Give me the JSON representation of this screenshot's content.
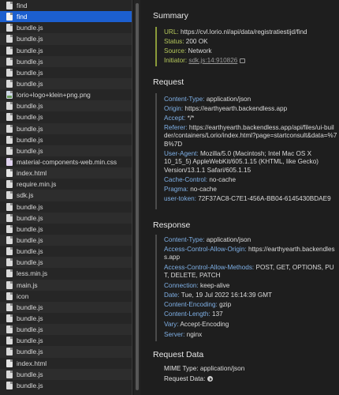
{
  "resources": [
    {
      "name": "find",
      "icon": "file-icon",
      "state": "normal"
    },
    {
      "name": "find",
      "icon": "file-icon",
      "state": "selected"
    },
    {
      "name": "bundle.js",
      "icon": "file-icon"
    },
    {
      "name": "bundle.js",
      "icon": "file-icon"
    },
    {
      "name": "bundle.js",
      "icon": "file-icon"
    },
    {
      "name": "bundle.js",
      "icon": "file-icon"
    },
    {
      "name": "bundle.js",
      "icon": "file-icon"
    },
    {
      "name": "bundle.js",
      "icon": "file-icon"
    },
    {
      "name": "lorio+logo+klein+png.png",
      "icon": "image-file-icon"
    },
    {
      "name": "bundle.js",
      "icon": "file-icon"
    },
    {
      "name": "bundle.js",
      "icon": "file-icon"
    },
    {
      "name": "bundle.js",
      "icon": "file-icon"
    },
    {
      "name": "bundle.js",
      "icon": "file-icon"
    },
    {
      "name": "bundle.js",
      "icon": "file-icon"
    },
    {
      "name": "material-components-web.min.css",
      "icon": "css-file-icon"
    },
    {
      "name": "index.html",
      "icon": "html-file-icon"
    },
    {
      "name": "require.min.js",
      "icon": "file-icon"
    },
    {
      "name": "sdk.js",
      "icon": "file-icon"
    },
    {
      "name": "bundle.js",
      "icon": "file-icon"
    },
    {
      "name": "bundle.js",
      "icon": "file-icon"
    },
    {
      "name": "bundle.js",
      "icon": "file-icon"
    },
    {
      "name": "bundle.js",
      "icon": "file-icon"
    },
    {
      "name": "bundle.js",
      "icon": "file-icon"
    },
    {
      "name": "bundle.js",
      "icon": "file-icon"
    },
    {
      "name": "less.min.js",
      "icon": "file-icon"
    },
    {
      "name": "main.js",
      "icon": "file-icon"
    },
    {
      "name": "icon",
      "icon": "file-icon"
    },
    {
      "name": "bundle.js",
      "icon": "file-icon"
    },
    {
      "name": "bundle.js",
      "icon": "file-icon"
    },
    {
      "name": "bundle.js",
      "icon": "file-icon"
    },
    {
      "name": "bundle.js",
      "icon": "file-icon"
    },
    {
      "name": "bundle.js",
      "icon": "file-icon"
    },
    {
      "name": "index.html",
      "icon": "html-file-icon"
    },
    {
      "name": "bundle.js",
      "icon": "file-icon"
    },
    {
      "name": "bundle.js",
      "icon": "file-icon"
    }
  ],
  "summary": {
    "title": "Summary",
    "url_key": "URL:",
    "url_val": "https://cvl.lorio.nl/api/data/registratiestijd/find",
    "status_key": "Status:",
    "status_val": "200 OK",
    "source_key": "Source:",
    "source_val": "Network",
    "initiator_key": "Initiator:",
    "initiator_val": "sdk.js:14:910826"
  },
  "request": {
    "title": "Request",
    "content_type_key": "Content-Type:",
    "content_type_val": "application/json",
    "origin_key": "Origin:",
    "origin_val": "https://earthyearth.backendless.app",
    "accept_key": "Accept:",
    "accept_val": "*/*",
    "referer_key": "Referer:",
    "referer_val": "https://earthyearth.backendless.app/api/files/ui-builder/containers/Lorio/index.html?page=startconsult&data=%7B%7D",
    "user_agent_key": "User-Agent:",
    "user_agent_val": "Mozilla/5.0 (Macintosh; Intel Mac OS X 10_15_5) AppleWebKit/605.1.15 (KHTML, like Gecko) Version/13.1.1 Safari/605.1.15",
    "cache_key": "Cache-Control:",
    "cache_val": "no-cache",
    "pragma_key": "Pragma:",
    "pragma_val": "no-cache",
    "token_key": "user-token:",
    "token_val": "72F37AC8-C7E1-456A-BB04-6145430BDAE9"
  },
  "response": {
    "title": "Response",
    "content_type_key": "Content-Type:",
    "content_type_val": "application/json",
    "acao_key": "Access-Control-Allow-Origin:",
    "acao_val": "https://earthyearth.backendless.app",
    "acam_key": "Access-Control-Allow-Methods:",
    "acam_val": "POST, GET, OPTIONS, PUT, DELETE, PATCH",
    "connection_key": "Connection:",
    "connection_val": "keep-alive",
    "date_key": "Date:",
    "date_val": "Tue, 19 Jul 2022 16:14:39 GMT",
    "encoding_key": "Content-Encoding:",
    "encoding_val": "gzip",
    "length_key": "Content-Length:",
    "length_val": "137",
    "vary_key": "Vary:",
    "vary_val": "Accept-Encoding",
    "server_key": "Server:",
    "server_val": "nginx"
  },
  "request_data": {
    "title": "Request Data",
    "mime_key": "MIME Type:",
    "mime_val": "application/json",
    "data_key": "Request Data:"
  }
}
